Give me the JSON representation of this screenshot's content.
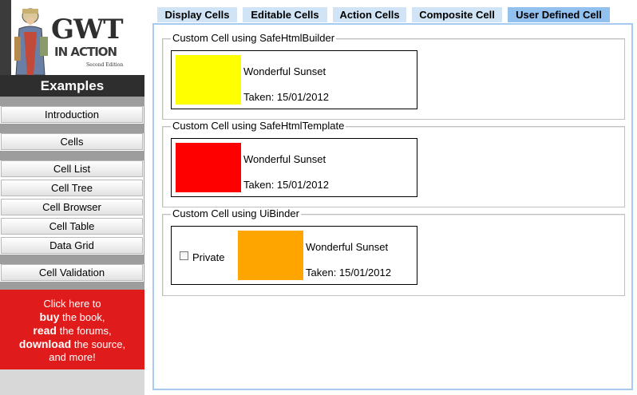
{
  "logo": {
    "title": "GWT",
    "subtitle": "IN ACTION",
    "edition": "Second Edition"
  },
  "sidebar": {
    "header": "Examples",
    "items": [
      {
        "label": "Introduction"
      },
      {
        "label": "Cells"
      },
      {
        "label": "Cell List"
      },
      {
        "label": "Cell Tree"
      },
      {
        "label": "Cell Browser"
      },
      {
        "label": "Cell Table"
      },
      {
        "label": "Data Grid"
      },
      {
        "label": "Cell Validation"
      }
    ],
    "promo": {
      "line1": "Click here to",
      "buy": "buy",
      "buy_rest": " the book,",
      "read": "read",
      "read_rest": " the forums,",
      "download": "download",
      "download_rest": " the source,",
      "line5": "and more!"
    }
  },
  "tabs": [
    {
      "label": "Display Cells",
      "active": false
    },
    {
      "label": "Editable Cells",
      "active": false
    },
    {
      "label": "Action Cells",
      "active": false
    },
    {
      "label": "Composite Cell",
      "active": false
    },
    {
      "label": "User Defined Cell",
      "active": true
    }
  ],
  "sections": [
    {
      "legend": "Custom Cell using SafeHtmlBuilder",
      "title": "Wonderful Sunset",
      "taken": "Taken: 15/01/2012",
      "color": "#ffff00"
    },
    {
      "legend": "Custom Cell using SafeHtmlTemplate",
      "title": "Wonderful Sunset",
      "taken": "Taken: 15/01/2012",
      "color": "#ff0000"
    },
    {
      "legend": "Custom Cell using UiBinder",
      "title": "Wonderful Sunset",
      "taken": "Taken: 15/01/2012",
      "color": "#ffa500",
      "checkbox_label": "Private",
      "checked": false
    }
  ],
  "colors": {
    "promo_bg": "#e01b1b",
    "tab_bg": "#d0e4f6",
    "tab_active_bg": "#92c1f0",
    "panel_border": "#a7cbf0"
  }
}
